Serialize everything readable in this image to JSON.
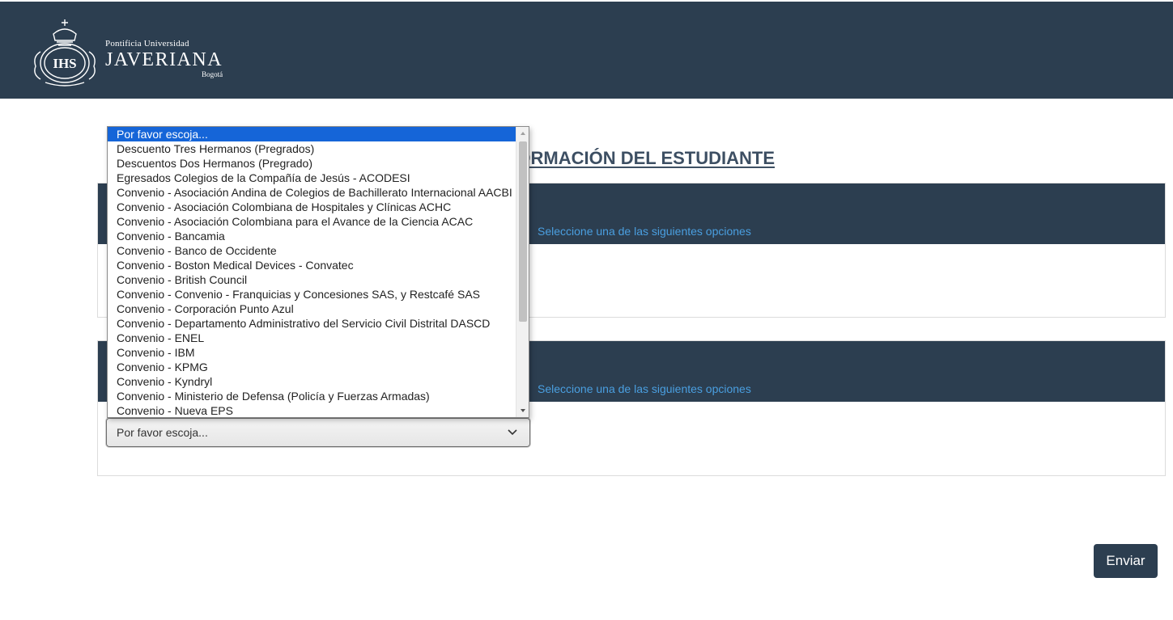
{
  "header": {
    "logo_small": "Pontificia Universidad",
    "logo_big": "JAVERIANA",
    "logo_city": "Bogotá",
    "logo_monogram": "IHS",
    "background": "#2c3e50"
  },
  "main": {
    "title": "INFORMACIÓN DEL ESTUDIANTE",
    "sections": [
      {
        "hint": "Seleccione una de las siguientes opciones"
      },
      {
        "hint": "Seleccione una de las siguientes opciones"
      }
    ]
  },
  "select": {
    "value": "Por favor escoja...",
    "icon": "chevron-down-icon"
  },
  "dropdown": {
    "options": [
      "Por favor escoja...",
      "Descuento Tres Hermanos (Pregrados)",
      "Descuentos Dos Hermanos (Pregrado)",
      "Egresados Colegios de la Compañía de Jesús - ACODESI",
      "Convenio - Asociación Andina de Colegios de Bachillerato Internacional AACBI",
      "Convenio - Asociación Colombiana de Hospitales y Clínicas ACHC",
      "Convenio - Asociación Colombiana para el Avance de la Ciencia ACAC",
      "Convenio - Bancamia",
      "Convenio - Banco de Occidente",
      "Convenio - Boston Medical Devices - Convatec",
      "Convenio - British Council",
      "Convenio - Convenio - Franquicias y Concesiones SAS, y Restcafé SAS",
      "Convenio - Corporación Punto Azul",
      "Convenio - Departamento Administrativo del Servicio Civil Distrital DASCD",
      "Convenio - ENEL",
      "Convenio - IBM",
      "Convenio - KPMG",
      "Convenio - Kyndryl",
      "Convenio - Ministerio de Defensa (Policía y Fuerzas Armadas)",
      "Convenio - Nueva EPS"
    ],
    "selected_index": 0,
    "selected_color": "#1565d8"
  },
  "actions": {
    "submit_label": "Enviar"
  }
}
